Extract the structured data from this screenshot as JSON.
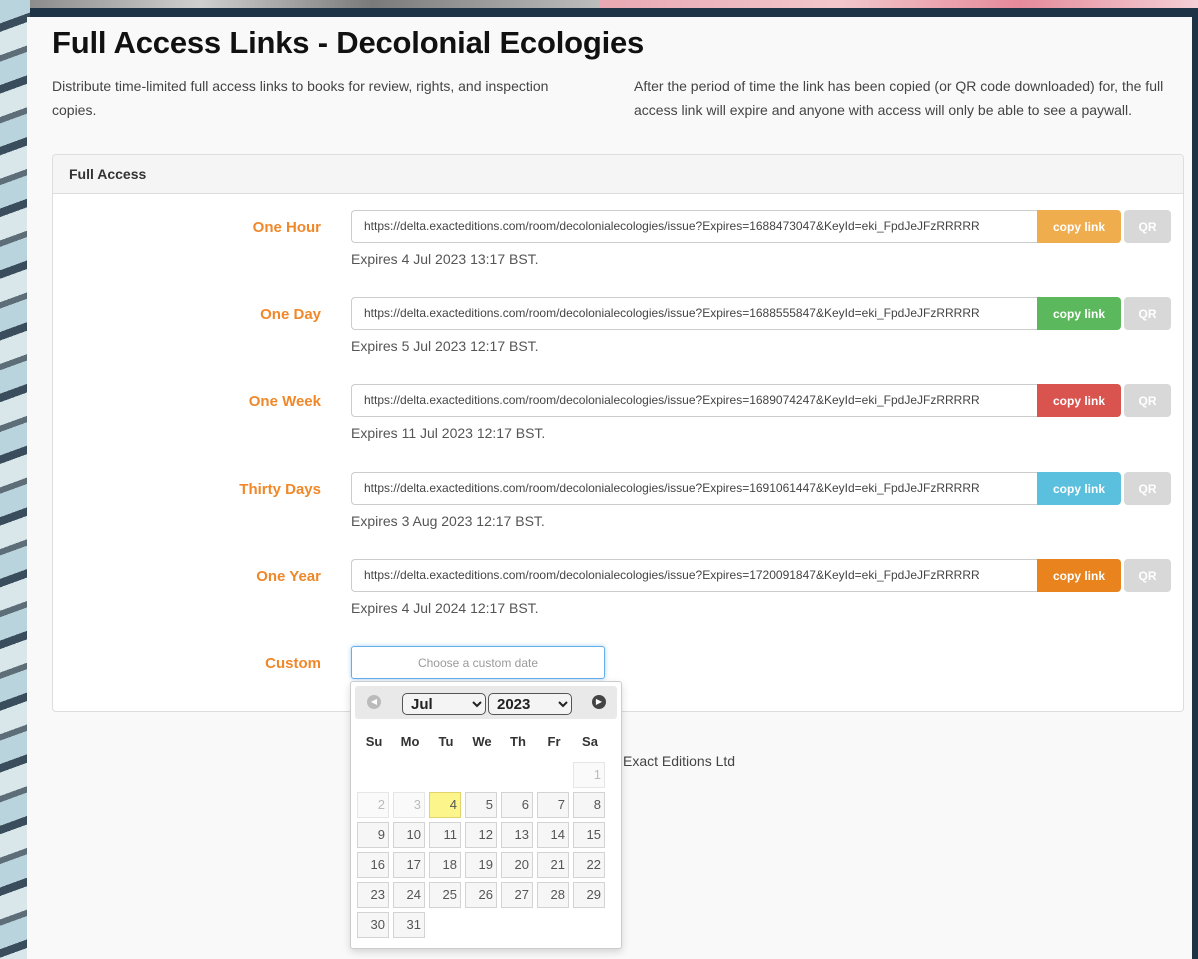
{
  "page": {
    "title": "Full Access Links - Decolonial Ecologies",
    "intro_left": "Distribute time-limited full access links to books for review, rights, and inspection copies.",
    "intro_right": "After the period of time the link has been copied (or QR code downloaded) for, the full access link will expire and anyone with access will only be able to see a paywall."
  },
  "panel": {
    "heading": "Full Access",
    "rows": [
      {
        "label": "One Hour",
        "url": "https://delta.exacteditions.com/room/decolonialecologies/issue?Expires=1688473047&KeyId=eki_FpdJeJFzRRRRR",
        "copy": "copy link",
        "qr": "QR",
        "expires": "Expires 4 Jul 2023 13:17 BST.",
        "color": "#f0ad4e"
      },
      {
        "label": "One Day",
        "url": "https://delta.exacteditions.com/room/decolonialecologies/issue?Expires=1688555847&KeyId=eki_FpdJeJFzRRRRR",
        "copy": "copy link",
        "qr": "QR",
        "expires": "Expires 5 Jul 2023 12:17 BST.",
        "color": "#5cb85c"
      },
      {
        "label": "One Week",
        "url": "https://delta.exacteditions.com/room/decolonialecologies/issue?Expires=1689074247&KeyId=eki_FpdJeJFzRRRRR",
        "copy": "copy link",
        "qr": "QR",
        "expires": "Expires 11 Jul 2023 12:17 BST.",
        "color": "#d9534f"
      },
      {
        "label": "Thirty Days",
        "url": "https://delta.exacteditions.com/room/decolonialecologies/issue?Expires=1691061447&KeyId=eki_FpdJeJFzRRRRR",
        "copy": "copy link",
        "qr": "QR",
        "expires": "Expires 3 Aug 2023 12:17 BST.",
        "color": "#5bc0de"
      },
      {
        "label": "One Year",
        "url": "https://delta.exacteditions.com/room/decolonialecologies/issue?Expires=1720091847&KeyId=eki_FpdJeJFzRRRRR",
        "copy": "copy link",
        "qr": "QR",
        "expires": "Expires 4 Jul 2024 12:17 BST.",
        "color": "#e8831e"
      }
    ],
    "custom": {
      "label": "Custom",
      "placeholder": "Choose a custom date"
    }
  },
  "footer": {
    "text": "Exact Editions Ltd"
  },
  "datepicker": {
    "prev_icon": "prev-arrow-icon",
    "next_icon": "next-arrow-icon",
    "month": "Jul",
    "year": "2023",
    "weekdays": [
      "Su",
      "Mo",
      "Tu",
      "We",
      "Th",
      "Fr",
      "Sa"
    ],
    "first_weekday_index": 6,
    "days_in_month": 31,
    "today": 4,
    "disabled_before": 4,
    "today_color": "#fbf58c"
  }
}
